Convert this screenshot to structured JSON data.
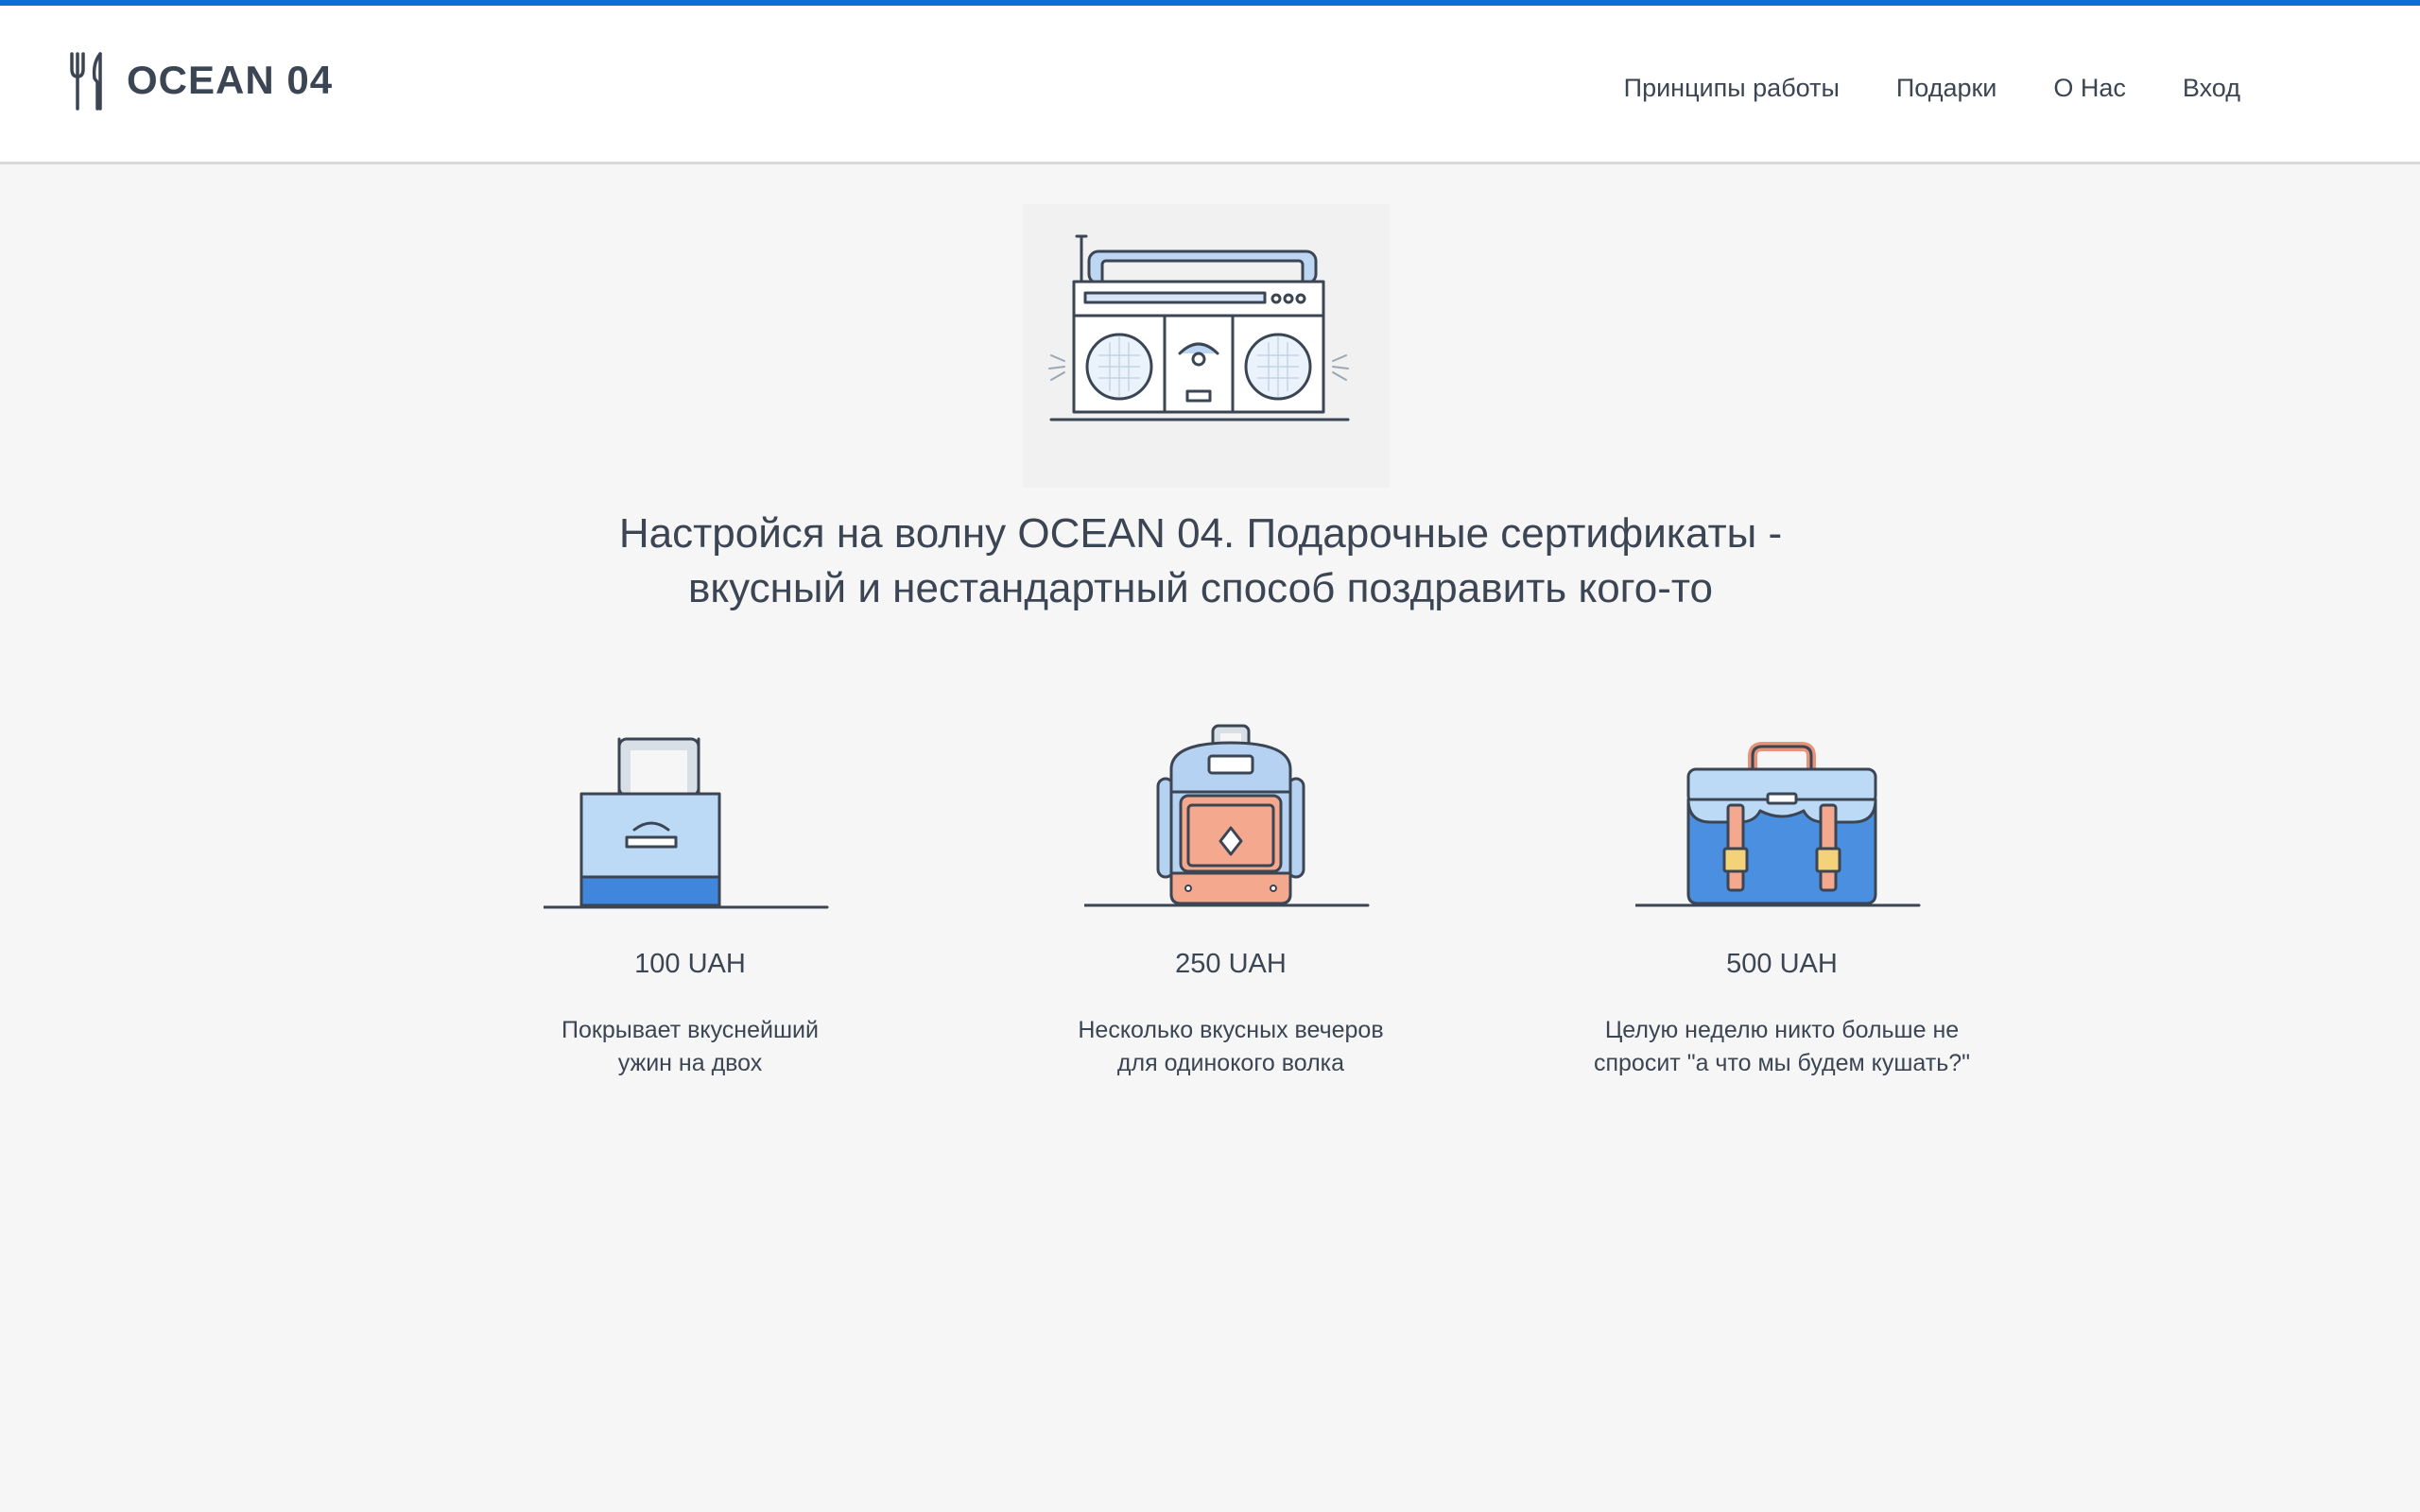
{
  "brand": {
    "name": "OCEAN 04",
    "accent_color": "#0b6fd8",
    "logo_icon": "fork-knife-icon"
  },
  "nav": {
    "items": [
      {
        "label": "Принципы работы"
      },
      {
        "label": "Подарки"
      },
      {
        "label": "О Нас"
      },
      {
        "label": "Вход"
      }
    ]
  },
  "hero": {
    "illustration": "boombox-icon",
    "headline_line1": "Настройся на волну OCEAN 04. Подарочные сертификаты -",
    "headline_line2": "вкусный и нестандартный способ поздравить кого-то"
  },
  "offers": [
    {
      "icon": "tote-bag-icon",
      "price": "100 UAH",
      "desc_line1": "Покрывает вкуснейший",
      "desc_line2": "ужин на двох"
    },
    {
      "icon": "backpack-icon",
      "price": "250 UAH",
      "desc_line1": "Несколько вкусных вечеров",
      "desc_line2": "для одинокого волка"
    },
    {
      "icon": "briefcase-icon",
      "price": "500 UAH",
      "desc_line1": "Целую неделю никто больше не",
      "desc_line2": "спросит \"а что мы будем кушать?\""
    }
  ]
}
